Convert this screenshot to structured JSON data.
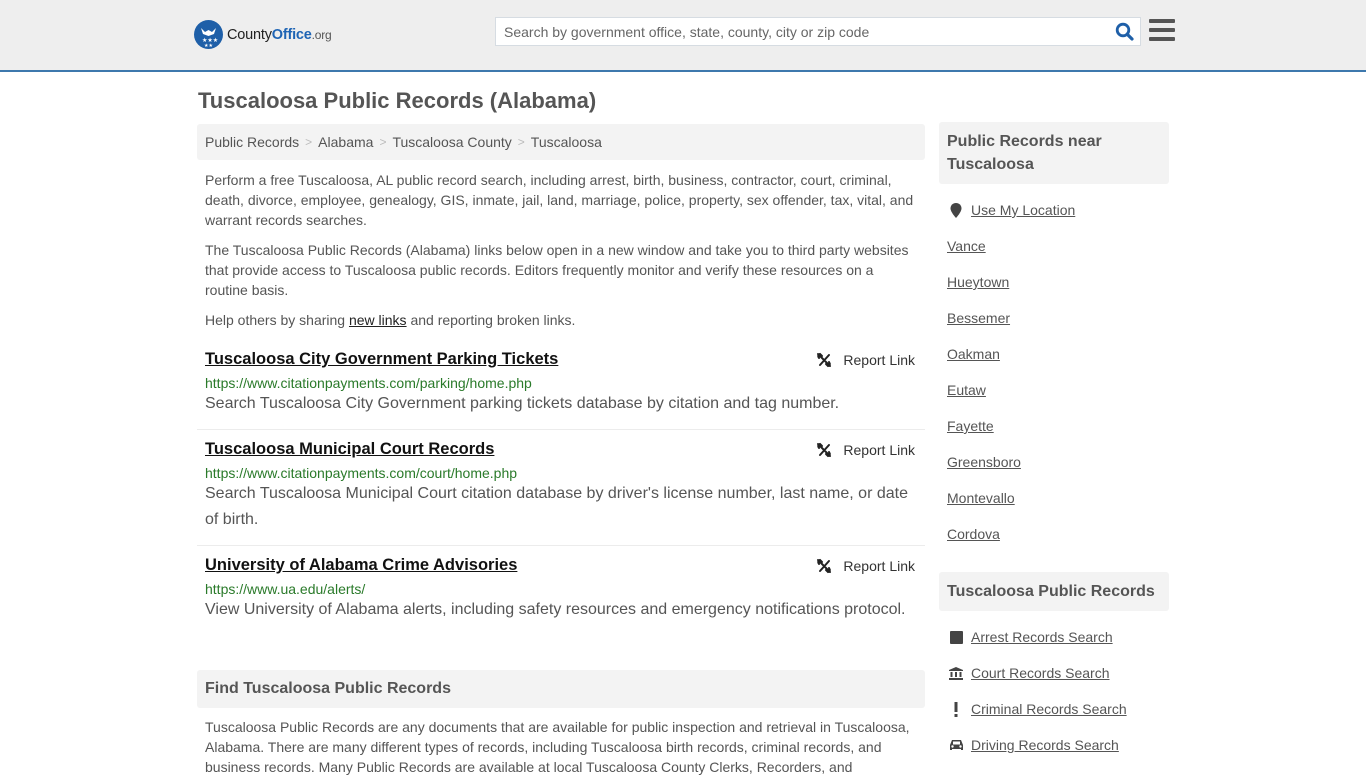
{
  "header": {
    "logo": {
      "county": "County",
      "office": "Office",
      "org": ".org"
    },
    "search_placeholder": "Search by government office, state, county, city or zip code",
    "search_value": ""
  },
  "page_title": "Tuscaloosa Public Records (Alabama)",
  "breadcrumb": [
    {
      "label": "Public Records"
    },
    {
      "label": "Alabama"
    },
    {
      "label": "Tuscaloosa County"
    },
    {
      "label": "Tuscaloosa"
    }
  ],
  "breadcrumb_separator": ">",
  "intro": {
    "p1": "Perform a free Tuscaloosa, AL public record search, including arrest, birth, business, contractor, court, criminal, death, divorce, employee, genealogy, GIS, inmate, jail, land, marriage, police, property, sex offender, tax, vital, and warrant records searches.",
    "p2": "The Tuscaloosa Public Records (Alabama) links below open in a new window and take you to third party websites that provide access to Tuscaloosa public records. Editors frequently monitor and verify these resources on a routine basis.",
    "p3_before": "Help others by sharing ",
    "p3_link": "new links",
    "p3_after": " and reporting broken links."
  },
  "records": [
    {
      "title": "Tuscaloosa City Government Parking Tickets",
      "url": "https://www.citationpayments.com/parking/home.php",
      "description": "Search Tuscaloosa City Government parking tickets database by citation and tag number.",
      "report_label": "Report Link"
    },
    {
      "title": "Tuscaloosa Municipal Court Records",
      "url": "https://www.citationpayments.com/court/home.php",
      "description": "Search Tuscaloosa Municipal Court citation database by driver's license number, last name, or date of birth.",
      "report_label": "Report Link"
    },
    {
      "title": "University of Alabama Crime Advisories",
      "url": "https://www.ua.edu/alerts/",
      "description": "View University of Alabama alerts, including safety resources and emergency notifications protocol.",
      "report_label": "Report Link"
    }
  ],
  "find_section": {
    "heading": "Find Tuscaloosa Public Records",
    "body": "Tuscaloosa Public Records are any documents that are available for public inspection and retrieval in Tuscaloosa, Alabama. There are many different types of records, including Tuscaloosa birth records, criminal records, and business records. Many Public Records are available at local Tuscaloosa County Clerks, Recorders, and"
  },
  "sidebar": {
    "nearby_heading": "Public Records near Tuscaloosa",
    "use_location": "Use My Location",
    "nearby": [
      "Vance",
      "Hueytown",
      "Bessemer",
      "Oakman",
      "Eutaw",
      "Fayette",
      "Greensboro",
      "Montevallo",
      "Cordova"
    ],
    "records_heading": "Tuscaloosa Public Records",
    "record_links": [
      {
        "label": "Arrest Records Search",
        "icon": "arrest-icon"
      },
      {
        "label": "Court Records Search",
        "icon": "courthouse-icon"
      },
      {
        "label": "Criminal Records Search",
        "icon": "exclamation-icon"
      },
      {
        "label": "Driving Records Search",
        "icon": "car-icon"
      }
    ]
  },
  "colors": {
    "brand_blue": "#1e5fa8",
    "header_border": "#3d78ad",
    "url_green": "#2a7a2a"
  }
}
